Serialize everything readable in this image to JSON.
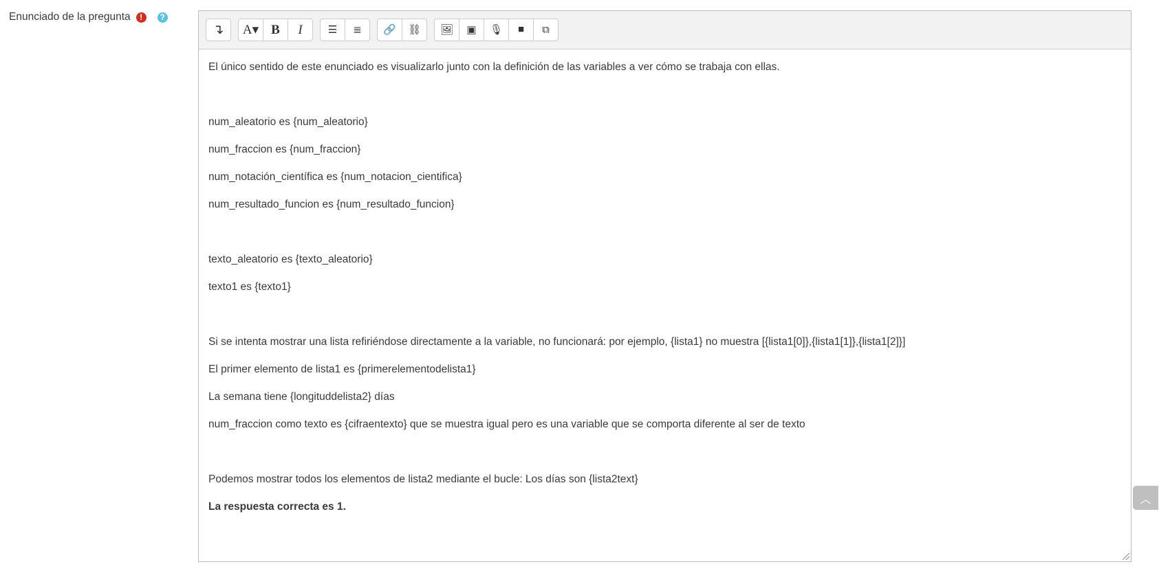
{
  "field": {
    "label": "Enunciado de la pregunta",
    "required_icon": "exclamation-circle-icon",
    "help_icon": "question-circle-icon"
  },
  "toolbar": {
    "groups": [
      [
        {
          "name": "collapse-button",
          "glyph": "↴"
        }
      ],
      [
        {
          "name": "font-style-button",
          "glyph": "A▾"
        },
        {
          "name": "bold-button",
          "glyph": "B"
        },
        {
          "name": "italic-button",
          "glyph": "I"
        }
      ],
      [
        {
          "name": "unordered-list-button",
          "glyph": "☰"
        },
        {
          "name": "ordered-list-button",
          "glyph": "≣"
        }
      ],
      [
        {
          "name": "link-button",
          "glyph": "🔗"
        },
        {
          "name": "unlink-button",
          "glyph": "⛓"
        }
      ],
      [
        {
          "name": "insert-image-button",
          "glyph": "🖼"
        },
        {
          "name": "insert-media-button",
          "glyph": "▣"
        },
        {
          "name": "record-audio-button",
          "glyph": "🎙"
        },
        {
          "name": "record-video-button",
          "glyph": "■"
        },
        {
          "name": "manage-files-button",
          "glyph": "⧉"
        }
      ]
    ]
  },
  "content": [
    {
      "text": "El único sentido de este enunciado es visualizarlo junto con la definición de las variables a ver cómo se trabaja con ellas."
    },
    {
      "text": ""
    },
    {
      "text": "num_aleatorio es {num_aleatorio}"
    },
    {
      "text": "num_fraccion es {num_fraccion}"
    },
    {
      "text": "num_notación_científica es {num_notacion_cientifica}"
    },
    {
      "text": "num_resultado_funcion es {num_resultado_funcion}"
    },
    {
      "text": ""
    },
    {
      "text": "texto_aleatorio es {texto_aleatorio}"
    },
    {
      "text": "texto1 es {texto1}"
    },
    {
      "text": ""
    },
    {
      "text": "Si se intenta mostrar una lista refiriéndose directamente a la variable, no funcionará: por ejemplo, {lista1} no muestra [{lista1[0]},{lista1[1]},{lista1[2]}]"
    },
    {
      "text": "El primer elemento de lista1 es {primerelementodelista1}"
    },
    {
      "text": "La semana tiene {longituddelista2} días"
    },
    {
      "text": "num_fraccion como texto es {cifraentexto} que se muestra igual pero es una variable que se comporta diferente al ser de texto"
    },
    {
      "text": ""
    },
    {
      "text": "Podemos mostrar todos los elementos de lista2 mediante el bucle: Los días son {lista2text}"
    },
    {
      "text": "La respuesta correcta es 1.",
      "bold": true
    }
  ],
  "back_to_top": {
    "icon": "chevron-up-icon"
  }
}
